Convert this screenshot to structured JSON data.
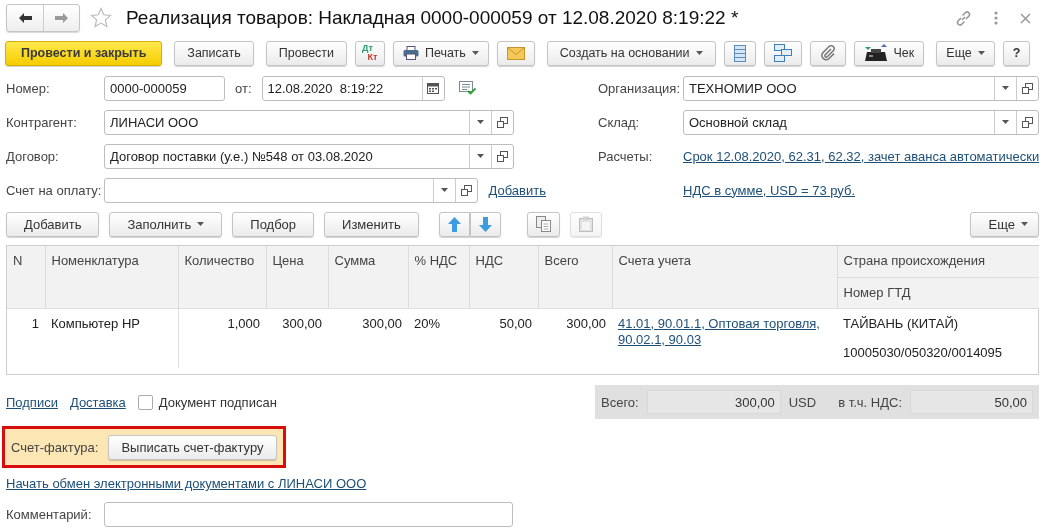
{
  "window": {
    "title": "Реализация товаров: Накладная 0000-000059 от 12.08.2020 8:19:22 *"
  },
  "toolbar": [
    {
      "kind": "primary",
      "label": "Провести и закрыть",
      "dropdown": false
    },
    {
      "kind": "text",
      "label": "Записать",
      "dropdown": false
    },
    {
      "kind": "text",
      "label": "Провести",
      "dropdown": false
    },
    {
      "kind": "dtkt",
      "labels": [
        "Дт",
        "Кт"
      ]
    },
    {
      "kind": "print",
      "label": "Печать",
      "dropdown": true
    },
    {
      "kind": "mail"
    },
    {
      "kind": "text",
      "label": "Создать на основании",
      "dropdown": true
    },
    {
      "kind": "list"
    },
    {
      "kind": "structure"
    },
    {
      "kind": "attach"
    },
    {
      "kind": "receipt",
      "label": "Чек",
      "dropdown": false
    },
    {
      "kind": "text",
      "label": "Еще",
      "dropdown": true
    },
    {
      "kind": "text",
      "label": "?",
      "dropdown": false
    }
  ],
  "header_fields": {
    "number": {
      "label": "Номер:",
      "value": "0000-000059"
    },
    "date": {
      "label": "от:",
      "value": "12.08.2020  8:19:22"
    }
  },
  "left_fields": [
    {
      "label": "Контрагент:",
      "value": "ЛИНАСИ ООО"
    },
    {
      "label": "Договор:",
      "value": "Договор поставки (у.е.) №548 от 03.08.2020"
    },
    {
      "label": "Счет на оплату:",
      "link": "Добавить"
    }
  ],
  "right_fields": [
    {
      "kind": "select",
      "label": "Организация:",
      "value": "ТЕХНОМИР ООО"
    },
    {
      "kind": "select",
      "label": "Склад:",
      "value": "Основной склад"
    },
    {
      "kind": "link",
      "label": "Расчеты:",
      "link": "Срок 12.08.2020, 62.31, 62.32, зачет аванса автоматически"
    },
    {
      "kind": "link",
      "link": "НДС в сумме, USD = 73 руб."
    }
  ],
  "goods_toolbar": [
    {
      "kind": "text",
      "label": "Добавить",
      "dropdown": false
    },
    {
      "kind": "text",
      "label": "Заполнить",
      "dropdown": true
    },
    {
      "kind": "text",
      "label": "Подбор",
      "dropdown": false
    },
    {
      "kind": "text",
      "label": "Изменить",
      "dropdown": false
    },
    {
      "kind": "up"
    },
    {
      "kind": "down"
    },
    {
      "kind": "copy",
      "disabled": false
    },
    {
      "kind": "paste",
      "disabled": true
    },
    {
      "kind": "text",
      "label": "Еще",
      "dropdown": true
    }
  ],
  "table": {
    "columns": [
      {
        "label": "N"
      },
      {
        "label": "Номенклатура"
      },
      {
        "label": "Количество"
      },
      {
        "label": "Цена"
      },
      {
        "label": "Сумма"
      },
      {
        "label": "% НДС"
      },
      {
        "label": "НДС"
      },
      {
        "label": "Всего"
      }
    ],
    "accounts_column": "Счета учета",
    "origin_column": {
      "label": "Страна происхождения",
      "sublabel": "Номер ГТД"
    },
    "rows": [
      {
        "cells": [
          "1",
          "Компьютер HP",
          "1,000",
          "300,00",
          "300,00",
          "20%",
          "50,00",
          "300,00"
        ],
        "accounts": "41.01, 90.01.1, Оптовая торговля, 90.02.1, 90.03",
        "country": "ТАЙВАНЬ (КИТАЙ)",
        "gtd": "10005030/050320/0014095"
      }
    ]
  },
  "footer": {
    "links": [
      "Подписи",
      "Доставка"
    ],
    "signed": {
      "label": "Документ подписан",
      "checked": false
    },
    "totals": {
      "total_label": "Всего:",
      "total": "300,00",
      "currency": "USD",
      "vat_label": "в т.ч. НДС:",
      "vat": "50,00"
    },
    "invoice": {
      "label": "Счет-фактура:",
      "button": "Выписать счет-фактуру",
      "highlighted": true
    },
    "edi_link": "Начать обмен электронными документами с ЛИНАСИ ООО",
    "comment": {
      "label": "Комментарий:"
    }
  }
}
